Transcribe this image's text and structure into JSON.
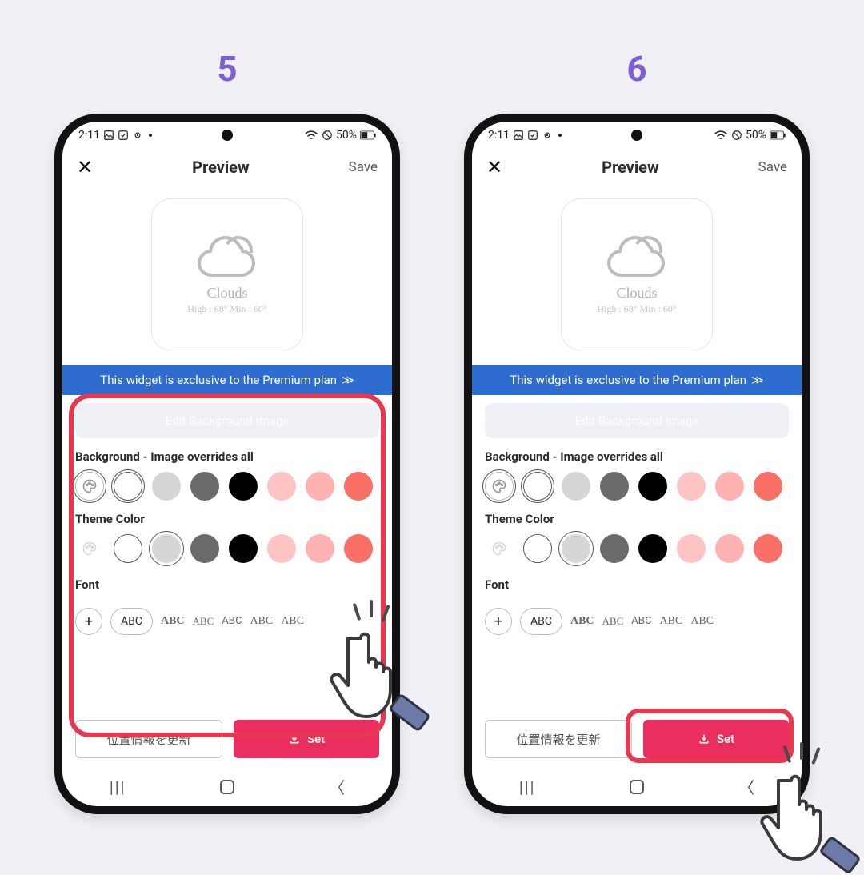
{
  "steps": {
    "left": "5",
    "right": "6"
  },
  "status": {
    "time": "2:11",
    "battery": "50%"
  },
  "header": {
    "title": "Preview",
    "save": "Save"
  },
  "preview": {
    "label": "Clouds",
    "sub": "High : 68° Min : 60°"
  },
  "banner": {
    "text": "This widget is exclusive to the Premium plan"
  },
  "editBar": {
    "label": "Edit Background Image"
  },
  "sections": {
    "bg": {
      "title": "Background - Image overrides all"
    },
    "theme": {
      "title": "Theme Color"
    },
    "font": {
      "title": "Font"
    }
  },
  "fonts": {
    "pill": "ABC",
    "free": [
      "ABC",
      "ABC",
      "ABC",
      "ABC",
      "ABC"
    ]
  },
  "bottom": {
    "ghost": "位置情報を更新",
    "primary": "Set"
  },
  "swatchColors": {
    "light": "#d6d6d6",
    "med": "#6a6a6a",
    "dark": "#2e2e2e",
    "black": "#000000",
    "pink1": "#ffc3c3",
    "pink2": "#ffb2b2",
    "coral": "#fb7066"
  }
}
